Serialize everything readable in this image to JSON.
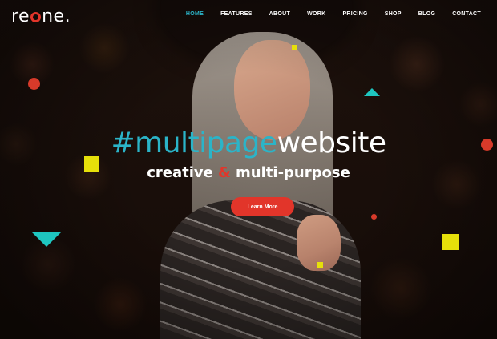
{
  "brand": {
    "logo_prefix": "re",
    "logo_suffix": "ne",
    "logo_dot": "."
  },
  "nav": {
    "items": [
      {
        "label": "HOME",
        "active": true
      },
      {
        "label": "FEATURES",
        "active": false
      },
      {
        "label": "ABOUT",
        "active": false
      },
      {
        "label": "WORK",
        "active": false
      },
      {
        "label": "PRICING",
        "active": false
      },
      {
        "label": "SHOP",
        "active": false
      },
      {
        "label": "BLOG",
        "active": false
      },
      {
        "label": "CONTACT",
        "active": false
      }
    ]
  },
  "hero": {
    "headline_accent": "#multipage",
    "headline_rest": "website",
    "sub_before": "creative ",
    "sub_amp": "&",
    "sub_after": " multi-purpose",
    "cta_label": "Learn More"
  },
  "colors": {
    "accent_teal": "#2bb4c8",
    "accent_red": "#e2352a",
    "accent_yellow": "#e6e00a",
    "shape_teal": "#1ec6c0"
  }
}
